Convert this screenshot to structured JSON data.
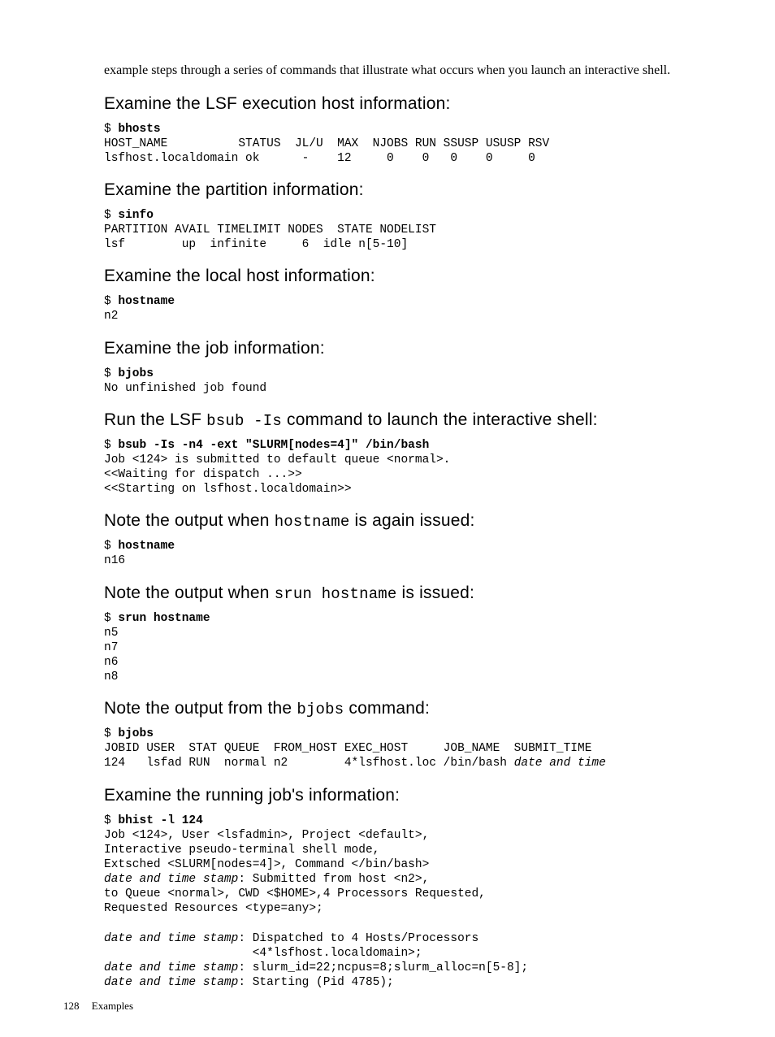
{
  "intro_paragraph": "example steps through a series of commands that illustrate what occurs when you launch an interactive shell.",
  "sections": [
    {
      "heading_parts": [
        {
          "t": "Examine the LSF execution host information:",
          "mono": false
        }
      ],
      "code_lines": [
        [
          {
            "t": "$ "
          },
          {
            "t": "bhosts",
            "b": true
          }
        ],
        [
          {
            "t": "HOST_NAME          STATUS  JL/U  MAX  NJOBS RUN SSUSP USUSP RSV"
          }
        ],
        [
          {
            "t": "lsfhost.localdomain ok      -    12     0    0   0    0     0"
          }
        ]
      ]
    },
    {
      "heading_parts": [
        {
          "t": "Examine the partition information:",
          "mono": false
        }
      ],
      "code_lines": [
        [
          {
            "t": "$ "
          },
          {
            "t": "sinfo",
            "b": true
          }
        ],
        [
          {
            "t": "PARTITION AVAIL TIMELIMIT NODES  STATE NODELIST"
          }
        ],
        [
          {
            "t": "lsf        up  infinite     6  idle n[5-10]"
          }
        ]
      ]
    },
    {
      "heading_parts": [
        {
          "t": "Examine the local host information:",
          "mono": false
        }
      ],
      "code_lines": [
        [
          {
            "t": "$ "
          },
          {
            "t": "hostname",
            "b": true
          }
        ],
        [
          {
            "t": "n2"
          }
        ]
      ]
    },
    {
      "heading_parts": [
        {
          "t": "Examine the job information:",
          "mono": false
        }
      ],
      "code_lines": [
        [
          {
            "t": "$ "
          },
          {
            "t": "bjobs",
            "b": true
          }
        ],
        [
          {
            "t": "No unfinished job found"
          }
        ]
      ]
    },
    {
      "heading_parts": [
        {
          "t": "Run the LSF ",
          "mono": false
        },
        {
          "t": "bsub -Is",
          "mono": true
        },
        {
          "t": " command to launch the interactive shell:",
          "mono": false
        }
      ],
      "code_lines": [
        [
          {
            "t": "$ "
          },
          {
            "t": "bsub -Is -n4 -ext \"SLURM[nodes=4]\" /bin/bash",
            "b": true
          }
        ],
        [
          {
            "t": "Job <124> is submitted to default queue <normal>."
          }
        ],
        [
          {
            "t": "<<Waiting for dispatch ...>>"
          }
        ],
        [
          {
            "t": "<<Starting on lsfhost.localdomain>>"
          }
        ]
      ]
    },
    {
      "heading_parts": [
        {
          "t": "Note the output when ",
          "mono": false
        },
        {
          "t": "hostname",
          "mono": true
        },
        {
          "t": " is again issued:",
          "mono": false
        }
      ],
      "code_lines": [
        [
          {
            "t": "$ "
          },
          {
            "t": "hostname",
            "b": true
          }
        ],
        [
          {
            "t": "n16"
          }
        ]
      ]
    },
    {
      "heading_parts": [
        {
          "t": "Note the output when ",
          "mono": false
        },
        {
          "t": "srun hostname",
          "mono": true
        },
        {
          "t": " is issued:",
          "mono": false
        }
      ],
      "code_lines": [
        [
          {
            "t": "$ "
          },
          {
            "t": "srun hostname",
            "b": true
          }
        ],
        [
          {
            "t": "n5"
          }
        ],
        [
          {
            "t": "n7"
          }
        ],
        [
          {
            "t": "n6"
          }
        ],
        [
          {
            "t": "n8"
          }
        ]
      ]
    },
    {
      "heading_parts": [
        {
          "t": "Note the output from the ",
          "mono": false
        },
        {
          "t": "bjobs",
          "mono": true
        },
        {
          "t": " command:",
          "mono": false
        }
      ],
      "code_lines": [
        [
          {
            "t": "$ "
          },
          {
            "t": "bjobs",
            "b": true
          }
        ],
        [
          {
            "t": "JOBID USER  STAT QUEUE  FROM_HOST EXEC_HOST     JOB_NAME  SUBMIT_TIME"
          }
        ],
        [
          {
            "t": "124   lsfad RUN  normal n2        4*lsfhost.loc /bin/bash "
          },
          {
            "t": "date and time",
            "i": true
          }
        ]
      ]
    },
    {
      "heading_parts": [
        {
          "t": "Examine the running job's information:",
          "mono": false
        }
      ],
      "code_lines": [
        [
          {
            "t": "$ "
          },
          {
            "t": "bhist -l 124",
            "b": true
          }
        ],
        [
          {
            "t": "Job <124>, User <lsfadmin>, Project <default>,"
          }
        ],
        [
          {
            "t": "Interactive pseudo-terminal shell mode,"
          }
        ],
        [
          {
            "t": "Extsched <SLURM[nodes=4]>, Command </bin/bash>"
          }
        ],
        [
          {
            "t": "date and time stamp",
            "i": true
          },
          {
            "t": ": Submitted from host <n2>,"
          }
        ],
        [
          {
            "t": "to Queue <normal>, CWD <$HOME>,4 Processors Requested,"
          }
        ],
        [
          {
            "t": "Requested Resources <type=any>;"
          }
        ],
        [
          {
            "t": ""
          }
        ],
        [
          {
            "t": "date and time stamp",
            "i": true
          },
          {
            "t": ": Dispatched to 4 Hosts/Processors"
          }
        ],
        [
          {
            "t": "                     <4*lsfhost.localdomain>;"
          }
        ],
        [
          {
            "t": "date and time stamp",
            "i": true
          },
          {
            "t": ": slurm_id=22;ncpus=8;slurm_alloc=n[5-8];"
          }
        ],
        [
          {
            "t": "date and time stamp",
            "i": true
          },
          {
            "t": ": Starting (Pid 4785);"
          }
        ]
      ]
    }
  ],
  "footer": {
    "page_number": "128",
    "section_label": "Examples"
  }
}
